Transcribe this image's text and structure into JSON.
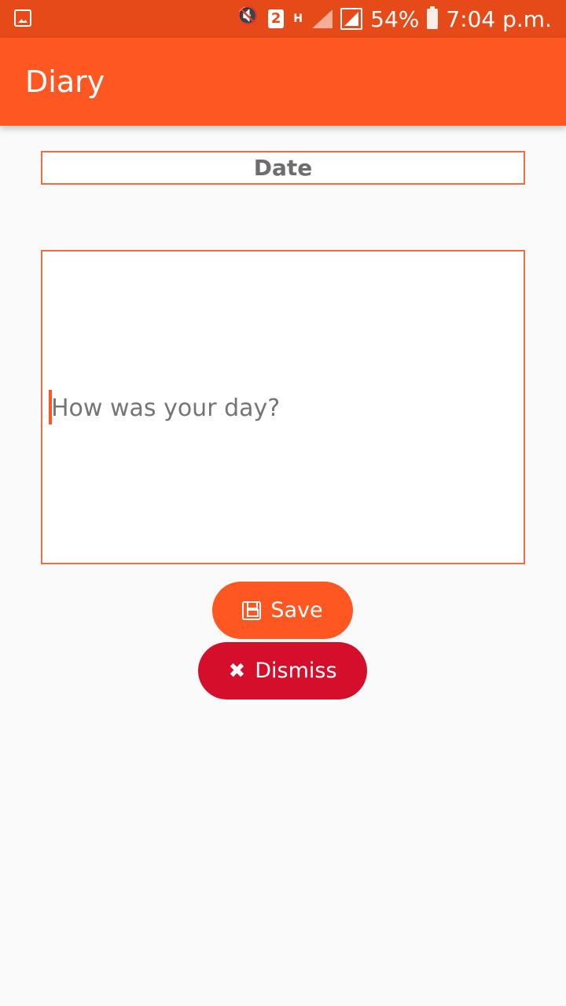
{
  "status_bar": {
    "icons": [
      "gallery-icon",
      "mute-vibrate-icon",
      "sim-2-icon",
      "hplus-icon",
      "signal-icon",
      "signal-icon-2",
      "battery-icon"
    ],
    "sim": "2",
    "network": "H",
    "battery_text": "54%",
    "time": "7:04 p.m."
  },
  "app_bar": {
    "title": "Diary"
  },
  "form": {
    "date_label": "Date",
    "entry_placeholder": "How was your day?"
  },
  "buttons": {
    "save_label": "Save",
    "save_icon": "floppy-disk-icon",
    "dismiss_label": "Dismiss",
    "dismiss_icon": "close-icon"
  },
  "colors": {
    "accent": "#ff5722",
    "status_bar": "#e64a19",
    "dismiss": "#d50f2b",
    "field_border": "#f26b43"
  }
}
